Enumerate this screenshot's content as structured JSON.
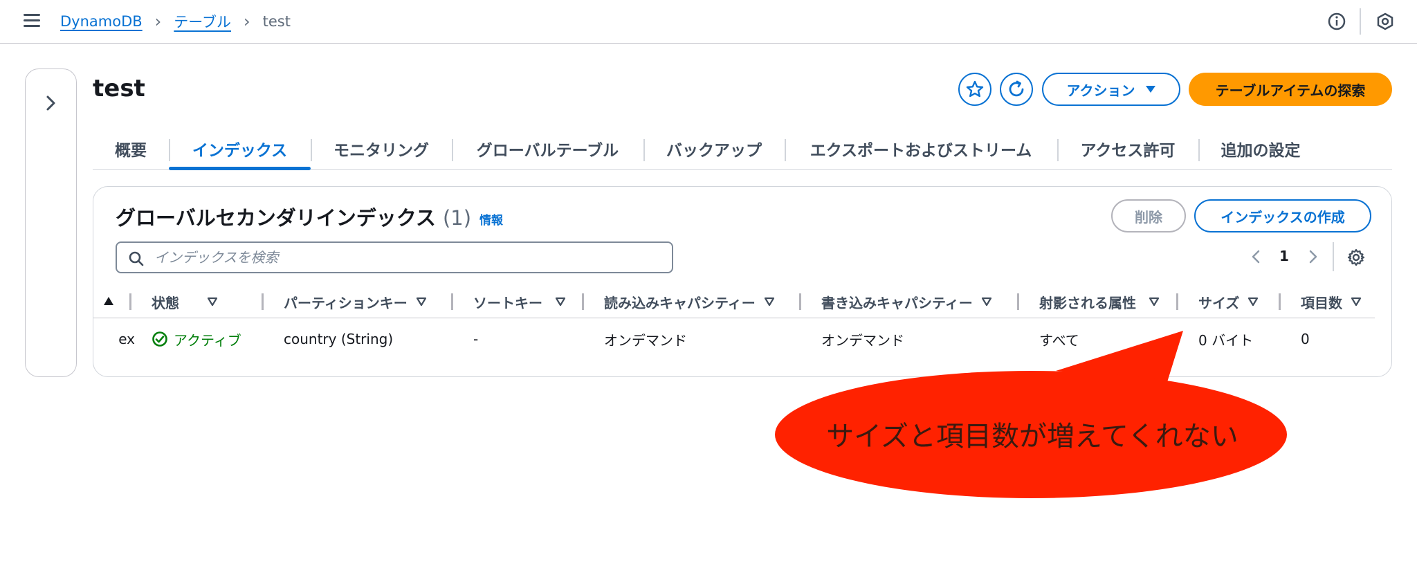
{
  "breadcrumb": {
    "items": [
      "DynamoDB",
      "テーブル"
    ],
    "current": "test"
  },
  "page": {
    "title": "test",
    "actions_label": "アクション",
    "explore_label": "テーブルアイテムの探索"
  },
  "tabs": [
    {
      "label": "概要"
    },
    {
      "label": "インデックス"
    },
    {
      "label": "モニタリング"
    },
    {
      "label": "グローバルテーブル"
    },
    {
      "label": "バックアップ"
    },
    {
      "label": "エクスポートおよびストリーム"
    },
    {
      "label": "アクセス許可"
    },
    {
      "label": "追加の設定"
    }
  ],
  "active_tab": "インデックス",
  "gsi": {
    "title": "グローバルセカンダリインデックス",
    "count": "(1)",
    "info": "情報",
    "delete_label": "削除",
    "create_label": "インデックスの作成",
    "search_placeholder": "インデックスを検索",
    "page": "1",
    "columns": [
      "状態",
      "パーティションキー",
      "ソートキー",
      "読み込みキャパシティー",
      "書き込みキャパシティー",
      "射影される属性",
      "サイズ",
      "項目数"
    ],
    "rows": [
      {
        "name": "ex",
        "status": "アクティブ",
        "partition_key": "country (String)",
        "sort_key": "-",
        "read_capacity": "オンデマンド",
        "write_capacity": "オンデマンド",
        "projected": "すべて",
        "size": "0 バイト",
        "items": "0"
      }
    ]
  },
  "annotation": {
    "text": "サイズと項目数が増えてくれない",
    "color": "#ff2200"
  },
  "colors": {
    "link": "#0972d3",
    "primary_button": "#ff9900",
    "status_active": "#037f0c"
  }
}
